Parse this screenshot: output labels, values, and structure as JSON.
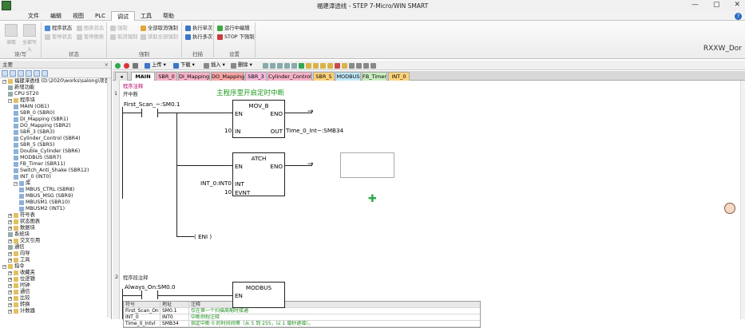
{
  "window": {
    "title": "福建漳透线 - STEP 7-Micro/WIN SMART",
    "min": "—",
    "max": "▢",
    "close": "✕"
  },
  "menu": [
    "文件",
    "编辑",
    "视图",
    "PLC",
    "调试",
    "工具",
    "帮助"
  ],
  "menu_active_index": 4,
  "ribbon": {
    "groups": [
      {
        "label": "读/写"
      },
      {
        "label": "状态"
      },
      {
        "label": "强制"
      },
      {
        "label": "扫描"
      },
      {
        "label": "设置"
      }
    ],
    "read_label": "读取",
    "write_all_label": "全部写入",
    "program_status": "程序状态",
    "table_status": "图表状态",
    "pause_status": "暂停状态",
    "pause_chart": "暂停图表",
    "force": "强制",
    "unforce": "取消强制",
    "unforce_all": "全部取消强制",
    "read_all_forced": "读取全部强制",
    "execute_single": "执行单次",
    "execute_multiple": "执行多次",
    "run_edit": "运行中编辑",
    "stop_force": "STOP 下强制"
  },
  "brand_text": "RXXW_Dor",
  "left_panel": {
    "header": "主要",
    "tree": [
      {
        "label": "福建漳透线 (D:\\2020\\works\\salong\\项目)",
        "level": 0,
        "exp": "−"
      },
      {
        "label": "新增功能",
        "level": 1
      },
      {
        "label": "CPU ST20",
        "level": 1
      },
      {
        "label": "程序块",
        "level": 1,
        "exp": "−"
      },
      {
        "label": "MAIN (OB1)",
        "level": 2
      },
      {
        "label": "SBR_0 (SBR0)",
        "level": 2
      },
      {
        "label": "DI_Mapping (SBR1)",
        "level": 2
      },
      {
        "label": "DO_Mapping (SBR2)",
        "level": 2
      },
      {
        "label": "SBR_3 (SBR3)",
        "level": 2
      },
      {
        "label": "Cylinder_Control (SBR4)",
        "level": 2
      },
      {
        "label": "SBR_5 (SBR5)",
        "level": 2
      },
      {
        "label": "Double_Cylinder (SBR6)",
        "level": 2
      },
      {
        "label": "MODBUS (SBR7)",
        "level": 2
      },
      {
        "label": "FB_Timer (SBR11)",
        "level": 2
      },
      {
        "label": "Switch_Anti_Shake (SBR12)",
        "level": 2
      },
      {
        "label": "INT_0 (INT0)",
        "level": 2
      },
      {
        "label": "库",
        "level": 2,
        "exp": "−"
      },
      {
        "label": "MBUS_CTRL (SBR8)",
        "level": 3
      },
      {
        "label": "MBUS_MSG (SBR9)",
        "level": 3
      },
      {
        "label": "MBUSM1 (SBR10)",
        "level": 3
      },
      {
        "label": "MBUSM2 (INT1)",
        "level": 3
      },
      {
        "label": "符号表",
        "level": 1,
        "exp": "+"
      },
      {
        "label": "状态图表",
        "level": 1,
        "exp": "+"
      },
      {
        "label": "数据块",
        "level": 1,
        "exp": "+"
      },
      {
        "label": "系统块",
        "level": 1
      },
      {
        "label": "交叉引用",
        "level": 1,
        "exp": "+"
      },
      {
        "label": "通信",
        "level": 1
      },
      {
        "label": "向导",
        "level": 1,
        "exp": "+"
      },
      {
        "label": "工具",
        "level": 1,
        "exp": "+"
      },
      {
        "label": "指令",
        "level": 0,
        "exp": "−"
      },
      {
        "label": "收藏夹",
        "level": 1,
        "exp": "+"
      },
      {
        "label": "位逻辑",
        "level": 1,
        "exp": "+"
      },
      {
        "label": "时钟",
        "level": 1,
        "exp": "+"
      },
      {
        "label": "通信",
        "level": 1,
        "exp": "+"
      },
      {
        "label": "比较",
        "level": 1,
        "exp": "+"
      },
      {
        "label": "转换",
        "level": 1,
        "exp": "+"
      },
      {
        "label": "计数器",
        "level": 1,
        "exp": "+"
      }
    ]
  },
  "editor_toolbar": {
    "upload": "上传",
    "download": "下载",
    "insert": "插入",
    "delete": "删除"
  },
  "tabs": [
    {
      "label": "MAIN",
      "color": "#ffffff",
      "active": true
    },
    {
      "label": "SBR_0",
      "color": "#f7b3c8"
    },
    {
      "label": "DI_Mapping",
      "color": "#f7b3c8"
    },
    {
      "label": "DO_Mapping",
      "color": "#f9a6a6"
    },
    {
      "label": "SBR_3",
      "color": "#f4b7d9"
    },
    {
      "label": "Cylinder_Control",
      "color": "#f7b3c8"
    },
    {
      "label": "SBR_5",
      "color": "#fdd27a"
    },
    {
      "label": "MODBUS",
      "color": "#bfe6f6"
    },
    {
      "label": "FB_Timer",
      "color": "#c9ecc0"
    },
    {
      "label": "INT_0",
      "color": "#fdd27a"
    }
  ],
  "ladder": {
    "program_comment": "程序注释",
    "network1": {
      "num": "1",
      "comment": "开中断",
      "green_title": "主程序里开启定时中断",
      "contact1": "First_Scan_~:SM0.1",
      "movb_title": "MOV_B",
      "en": "EN",
      "eno": "ENO",
      "in_label": "IN",
      "in_value": "10",
      "out_label": "OUT",
      "out_value": "Time_0_Int~:SMB34",
      "attach_title": "ATCH",
      "int_label": "INT",
      "int_value": "INT_0:INT0",
      "evnt_label": "EVNT",
      "evnt_value": "10",
      "eni": "ENI"
    },
    "symbol_table": {
      "headers": [
        "符号",
        "地址",
        "注释"
      ],
      "rows": [
        [
          "First_Scan_On",
          "SM0.1",
          "仅在第一个扫描周期时接通"
        ],
        [
          "INT_0",
          "INT0",
          "中断例程注释"
        ],
        [
          "Time_0_Intvl",
          "SMB34",
          "指定中断 0 的时间间隔（从 5 到 255，以 1 毫秒递增）。"
        ]
      ]
    },
    "network2": {
      "num": "2",
      "comment": "程序段注释",
      "contact1": "Always_On:SM0.0",
      "modbus_title": "MODBUS",
      "en": "EN"
    }
  }
}
